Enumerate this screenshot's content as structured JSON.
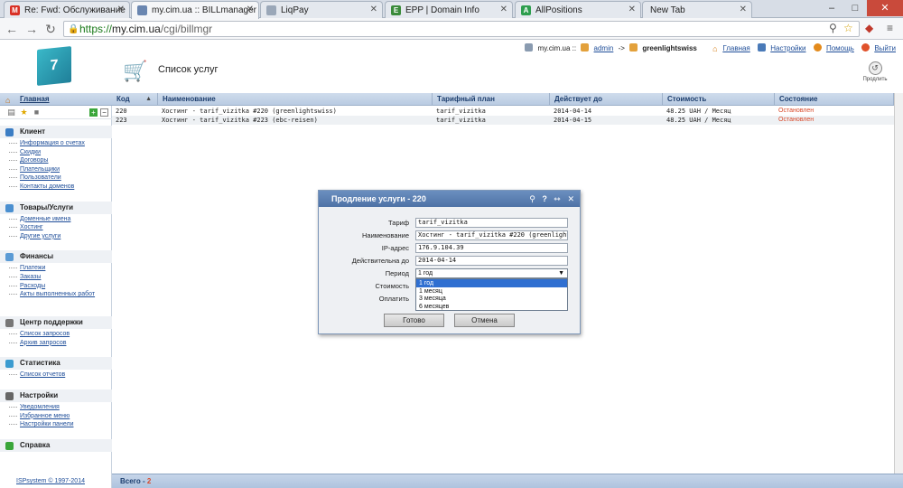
{
  "browser": {
    "tabs": [
      {
        "label": "Re: Fwd: Обслуживание",
        "icon": "gmail-icon",
        "color": "#d93025",
        "glyph": "M",
        "active": false
      },
      {
        "label": "my.cim.ua :: BILLmanager",
        "icon": "page-icon",
        "color": "#6a86b0",
        "glyph": "",
        "active": true
      },
      {
        "label": "LiqPay",
        "icon": "page-icon",
        "color": "#9aa7b8",
        "glyph": "",
        "active": false
      },
      {
        "label": "EPP | Domain Info",
        "icon": "epp-icon",
        "color": "#3a8b3a",
        "glyph": "E",
        "active": false
      },
      {
        "label": "AllPositions",
        "icon": "allpositions-icon",
        "color": "#2e9e4e",
        "glyph": "A",
        "active": false
      },
      {
        "label": "New Tab",
        "icon": "",
        "color": "",
        "glyph": "",
        "active": false
      }
    ],
    "url_scheme": "https://",
    "url_host": "my.cim.ua",
    "url_path": "/cgi/billmgr"
  },
  "header": {
    "title": "Список услуг",
    "site": "my.cim.ua ::",
    "user": "admin",
    "arrow": "->",
    "client": "greenlightswiss",
    "links": {
      "home": "Главная",
      "settings": "Настройки",
      "help": "Помощь",
      "logout": "Выйти"
    },
    "continue_label": "Продлить"
  },
  "sidebar": {
    "home": "Главная",
    "groups": [
      {
        "title": "Клиент",
        "color": "#3b7dc4",
        "items": [
          "Информация о счетах",
          "Скидки",
          "Договоры",
          "Плательщики",
          "Пользователи",
          "Контакты доменов"
        ]
      },
      {
        "title": "Товары/Услуги",
        "color": "#4a8fd0",
        "items": [
          "Доменные имена",
          "Хостинг",
          "Другие услуги"
        ]
      },
      {
        "title": "Финансы",
        "color": "#5b9bd5",
        "items": [
          "Платежи",
          "Заказы",
          "Расходы",
          "Акты выполненных работ"
        ]
      },
      {
        "title": "Центр поддержки",
        "color": "#777777",
        "items": [
          "Список запросов",
          "Архив запросов"
        ]
      },
      {
        "title": "Статистика",
        "color": "#3b9bd0",
        "items": [
          "Список отчетов"
        ]
      },
      {
        "title": "Настройки",
        "color": "#666666",
        "items": [
          "Уведомления",
          "Избранное меню",
          "Настройки панели"
        ]
      },
      {
        "title": "Справка",
        "color": "#3aa63a",
        "items": []
      }
    ],
    "footer": "ISPsystem © 1997-2014"
  },
  "table": {
    "columns": [
      "Код",
      "Наименование",
      "Тарифный план",
      "Действует до",
      "Стоимость",
      "Состояние"
    ],
    "rows": [
      [
        "220",
        "Хостинг - tarif_vizitka #220 (greenlightswiss)",
        "tarif_vizitka",
        "2014-04-14",
        "48.25 UAH / Месяц",
        "Остановлен"
      ],
      [
        "223",
        "Хостинг - tarif_vizitka #223 (ebc-reisen)",
        "tarif_vizitka",
        "2014-04-15",
        "48.25 UAH / Месяц",
        "Остановлен"
      ]
    ],
    "total_label": "Всего -",
    "total_value": "2"
  },
  "dialog": {
    "title": "Продление услуги - 220",
    "fields": {
      "tariff_label": "Тариф",
      "tariff_value": "tarif_vizitka",
      "name_label": "Наименование",
      "name_value": "Хостинг - tarif_vizitka #220 (greenlights",
      "ip_label": "IP-адрес",
      "ip_value": "176.9.104.39",
      "valid_label": "Действительна до",
      "valid_value": "2014-04-14",
      "period_label": "Период",
      "period_value": "1 год",
      "cost_label": "Стоимость",
      "pay_label": "Оплатить"
    },
    "period_options": [
      "1 год",
      "1 месяц",
      "3 месяца",
      "6 месяцев"
    ],
    "selected_option": 0,
    "ok_label": "Готово",
    "cancel_label": "Отмена"
  }
}
